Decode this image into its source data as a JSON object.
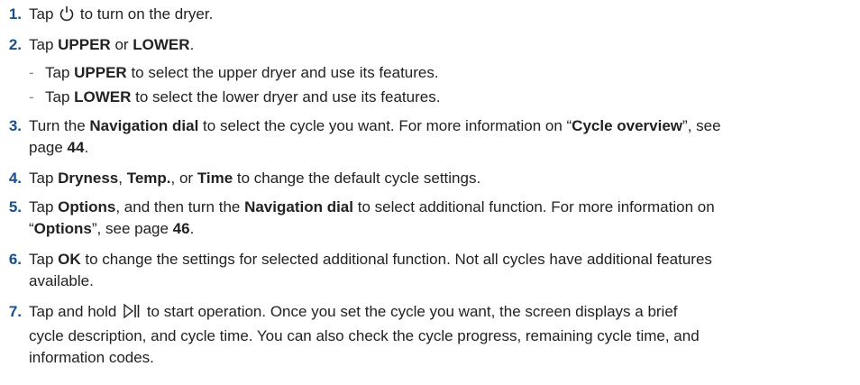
{
  "steps": [
    {
      "num": "1.",
      "pre": "Tap ",
      "icon": "power-icon",
      "post": " to turn on the dryer."
    },
    {
      "num": "2.",
      "t1": "Tap ",
      "b1": "UPPER",
      "t2": " or ",
      "b2": "LOWER",
      "t3": "."
    },
    {
      "num": "3.",
      "t1": "Turn the ",
      "b1": "Navigation dial",
      "t2": " to select the cycle you want. For more information on “",
      "b2": "Cycle overview",
      "t3": "”, see",
      "t4": "page ",
      "b3": "44",
      "t5": "."
    },
    {
      "num": "4.",
      "t1": "Tap ",
      "b1": "Dryness",
      "t2": ", ",
      "b2": "Temp.",
      "t3": ", or ",
      "b3": "Time",
      "t4": " to change the default cycle settings."
    },
    {
      "num": "5.",
      "t1": "Tap ",
      "b1": "Options",
      "t2": ", and then turn the ",
      "b2": "Navigation dial",
      "t3": " to select additional function. For more information on",
      "t4": "“",
      "b3": "Options",
      "t5": "”, see page ",
      "b4": "46",
      "t6": "."
    },
    {
      "num": "6.",
      "t1": "Tap ",
      "b1": "OK",
      "t2": " to change the settings for selected additional function. Not all cycles have additional features",
      "t3": "available."
    },
    {
      "num": "7.",
      "t1": "Tap and hold ",
      "icon": "play-pause-icon",
      "t2": " to start operation. Once you set the cycle you want, the screen displays a brief",
      "l2": "cycle description, and cycle time. You can also check the cycle progress, remaining cycle time, and",
      "l3": "information codes."
    }
  ],
  "substeps": [
    {
      "dash": "-",
      "t1": "Tap ",
      "b1": "UPPER",
      "t2": " to select the upper dryer and use its features."
    },
    {
      "dash": "-",
      "t1": "Tap ",
      "b1": "LOWER",
      "t2": " to select the lower dryer and use its features."
    }
  ]
}
